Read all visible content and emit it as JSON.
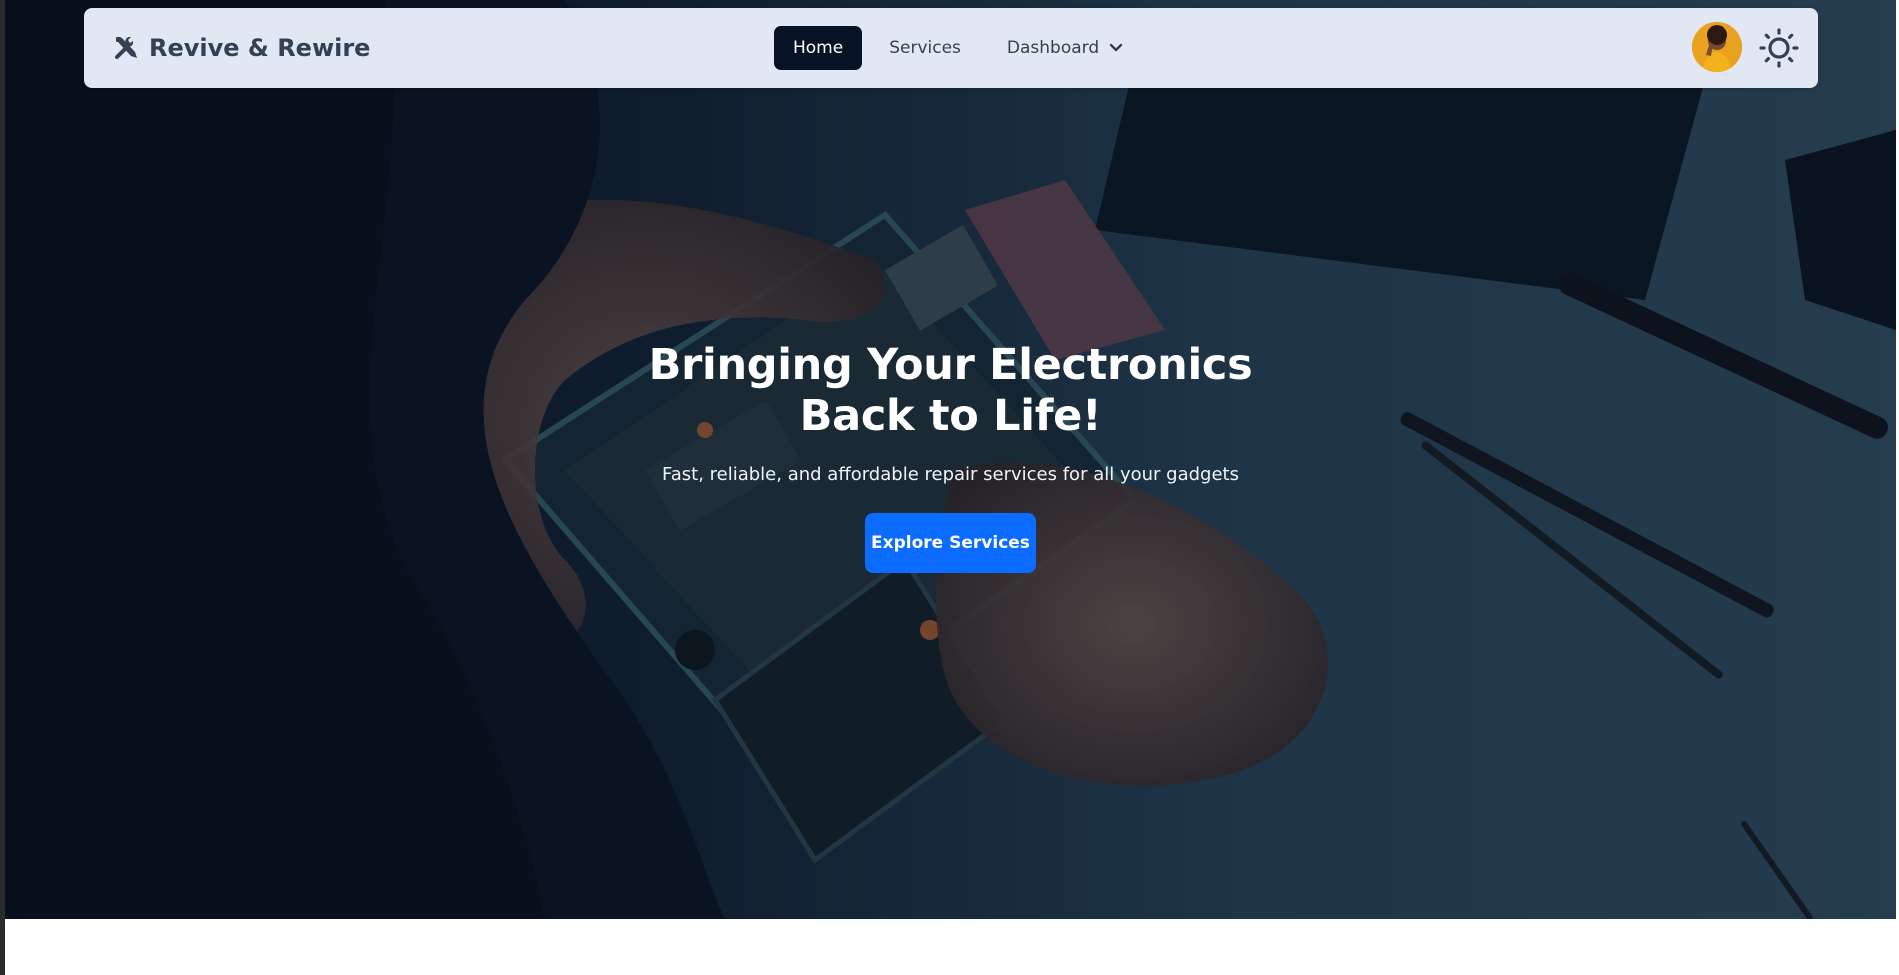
{
  "brand": {
    "name": "Revive & Rewire",
    "icon": "tools-icon"
  },
  "nav": {
    "items": [
      {
        "label": "Home",
        "active": true
      },
      {
        "label": "Services",
        "active": false
      },
      {
        "label": "Dashboard",
        "active": false,
        "dropdown": true
      }
    ]
  },
  "user": {
    "avatar": "user-avatar"
  },
  "theme_toggle": {
    "icon": "sun-icon"
  },
  "hero": {
    "title": "Bringing Your Electronics Back to Life!",
    "subtitle": "Fast, reliable, and affordable repair services for all your gadgets",
    "cta_label": "Explore Services"
  },
  "colors": {
    "navbar_bg": "#e2e8f3",
    "nav_active_bg": "#081227",
    "cta_bg": "#0b6cff",
    "avatar_bg": "#e9a21f"
  }
}
